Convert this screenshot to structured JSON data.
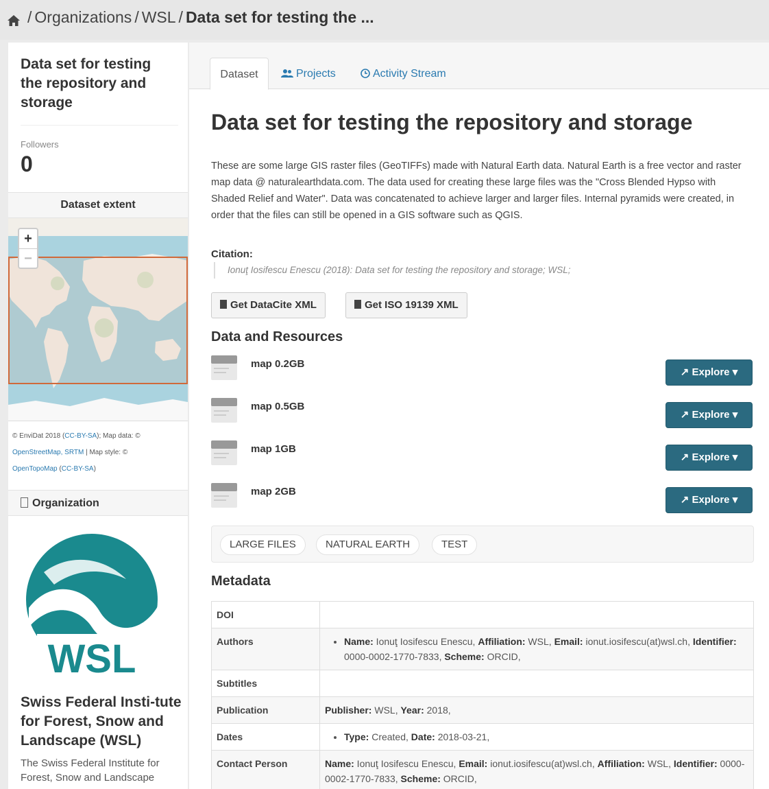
{
  "breadcrumb": {
    "items": [
      "Organizations",
      "WSL"
    ],
    "current": "Data set for testing the ..."
  },
  "sidebar": {
    "dataset_title": "Data set for testing the repository and storage",
    "followers_label": "Followers",
    "followers_count": "0",
    "extent_heading": "Dataset extent",
    "zoom_in": "+",
    "zoom_out": "−",
    "attribution": {
      "part1": "© EnviDat 2018 (",
      "link1": "CC-BY-SA",
      "part2": "); Map data: ©",
      "link2": "OpenStreetMap, SRTM",
      "part3": " | Map style: ©",
      "link3": "OpenTopoMap",
      "part4": " (",
      "link4": "CC-BY-SA",
      "part5": ")"
    },
    "org_heading": "Organization",
    "logo_text": "WSL",
    "org_name": "Swiss Federal Insti-tute for Forest, Snow and Landscape (WSL)",
    "org_description": "The Swiss Federal Institute for Forest, Snow and Landscape"
  },
  "tabs": [
    {
      "label": "Dataset",
      "icon": "none",
      "active": true
    },
    {
      "label": "Projects",
      "icon": "users-icon",
      "active": false
    },
    {
      "label": "Activity Stream",
      "icon": "clock-icon",
      "active": false
    }
  ],
  "dataset": {
    "title": "Data set for testing the repository and storage",
    "description": "These are some large GIS raster files (GeoTIFFs) made with Natural Earth data. Natural Earth is a free vector and raster map data @ naturalearthdata.com. The data used for creating these large files was the \"Cross Blended Hypso with Shaded Relief and Water\". Data was concatenated to achieve larger and larger files. Internal pyramids were created, in order that the files can still be opened in a GIS software such as QGIS.",
    "citation_label": "Citation:",
    "citation_text": "Ionuţ Iosifescu Enescu (2018): Data set for testing the repository and storage; WSL;",
    "btn_datacite": "Get DataCite XML",
    "btn_iso": "Get ISO 19139 XML"
  },
  "resources": {
    "heading": "Data and Resources",
    "explore_label": "Explore",
    "items": [
      {
        "name": "map 0.2GB"
      },
      {
        "name": "map 0.5GB"
      },
      {
        "name": "map 1GB"
      },
      {
        "name": "map 2GB"
      }
    ]
  },
  "tags": [
    "LARGE FILES",
    "NATURAL EARTH",
    "TEST"
  ],
  "metadata": {
    "heading": "Metadata",
    "rows": {
      "doi": {
        "label": "DOI"
      },
      "authors": {
        "label": "Authors",
        "name_key": "Name:",
        "name_val": " Ionuţ Iosifescu Enescu, ",
        "aff_key": "Affiliation:",
        "aff_val": " WSL, ",
        "email_key": "Email:",
        "email_val": " ionut.iosifescu(at)wsl.ch, ",
        "id_key": "Identifier:",
        "id_val": " 0000-0002-1770-7833, ",
        "scheme_key": "Scheme:",
        "scheme_val": " ORCID,"
      },
      "subtitles": {
        "label": "Subtitles"
      },
      "publication": {
        "label": "Publication",
        "pub_key": "Publisher:",
        "pub_val": " WSL, ",
        "year_key": "Year:",
        "year_val": " 2018,"
      },
      "dates": {
        "label": "Dates",
        "type_key": "Type:",
        "type_val": " Created, ",
        "date_key": "Date:",
        "date_val": " 2018-03-21,"
      },
      "contact": {
        "label": "Contact Person",
        "name_key": "Name:",
        "name_val": " Ionuţ Iosifescu Enescu, ",
        "email_key": "Email:",
        "email_val": " ionut.iosifescu(at)wsl.ch, ",
        "aff_key": "Affiliation:",
        "aff_val": " WSL, ",
        "id_key": "Identifier:",
        "id_val": " 0000-0002-1770-7833, ",
        "scheme_key": "Scheme:",
        "scheme_val": " ORCID,"
      }
    }
  },
  "colors": {
    "explore_button": "#2b6a80",
    "link": "#2a7ab0",
    "logo_teal": "#1a8a8e",
    "extent_border": "#d0693a",
    "map_water": "#aad3df"
  }
}
